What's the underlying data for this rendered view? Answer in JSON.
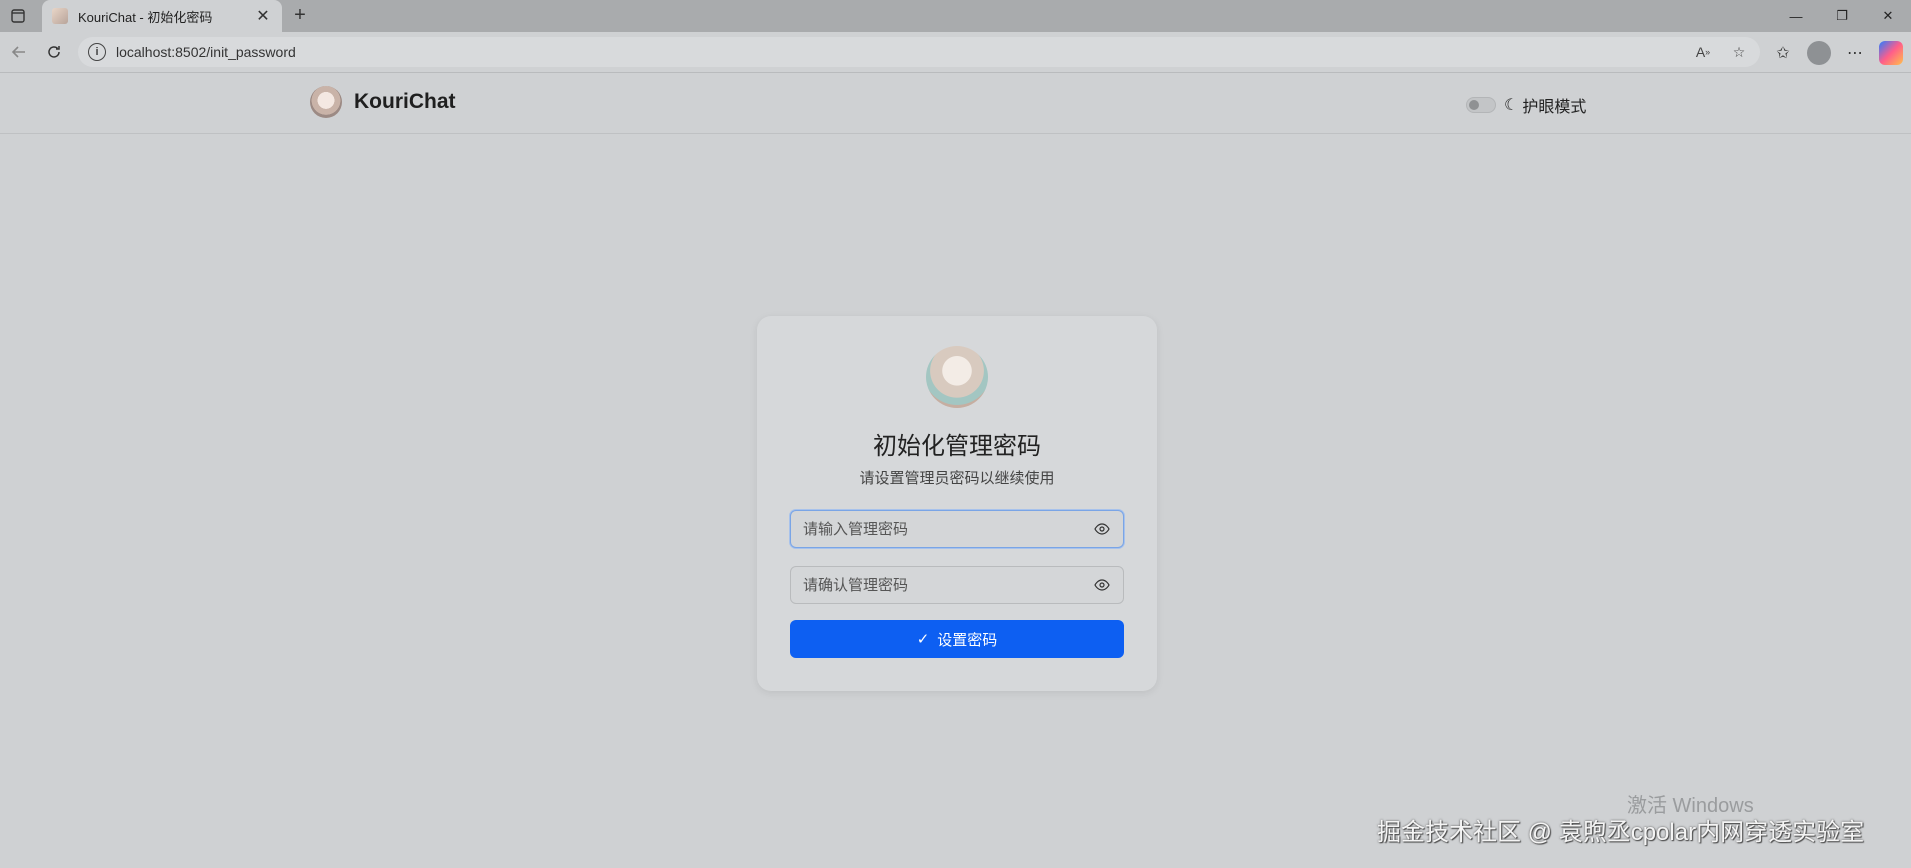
{
  "browser": {
    "tab_title": "KouriChat - 初始化密码",
    "new_tab": "+",
    "tab_close": "✕",
    "url": "localhost:8502/init_password",
    "window_controls": [
      "—",
      "❐",
      "✕"
    ]
  },
  "header": {
    "brand": "KouriChat",
    "eye_mode_label": "护眼模式",
    "eye_mode_on": false
  },
  "card": {
    "title": "初始化管理密码",
    "subtitle": "请设置管理员密码以继续使用",
    "password_placeholder": "请输入管理密码",
    "confirm_placeholder": "请确认管理密码",
    "submit_label": "设置密码"
  },
  "watermarks": {
    "activate": "激活 Windows",
    "juejin": "掘金技术社区 @ 袁煦丞cpolar内网穿透实验室"
  },
  "colors": {
    "primary_button": "#0d5ff2",
    "page_bg": "#cfd1d3",
    "card_bg": "#d6d8da"
  }
}
